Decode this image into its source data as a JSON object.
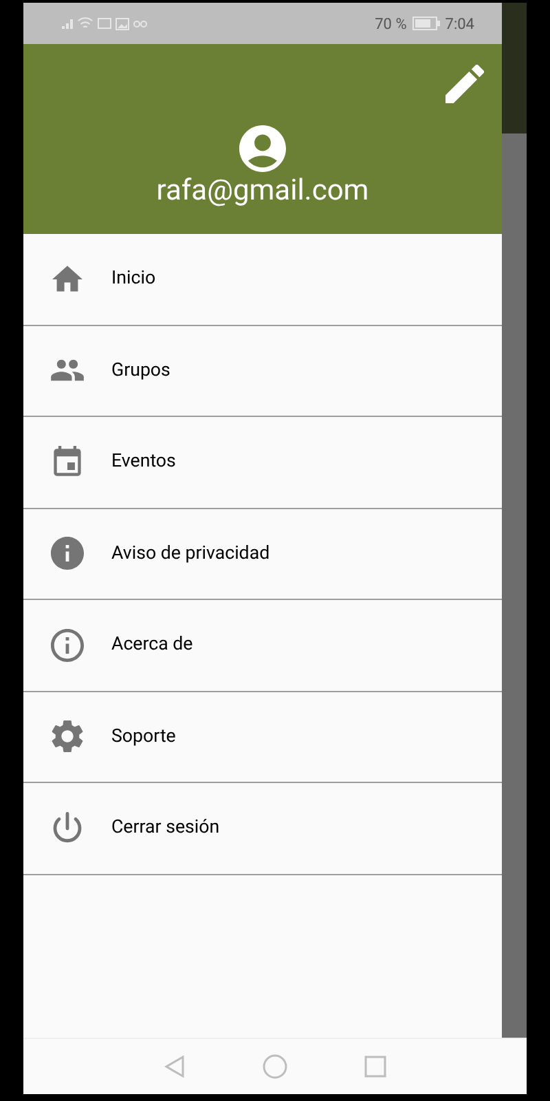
{
  "status_bar": {
    "battery": "70 %",
    "time": "7:04"
  },
  "drawer_header": {
    "email": "rafa@gmail.com"
  },
  "menu_items": [
    {
      "label": "Inicio"
    },
    {
      "label": "Grupos"
    },
    {
      "label": "Eventos"
    },
    {
      "label": "Aviso de privacidad"
    },
    {
      "label": "Acerca de"
    },
    {
      "label": "Soporte"
    },
    {
      "label": "Cerrar sesión"
    }
  ]
}
